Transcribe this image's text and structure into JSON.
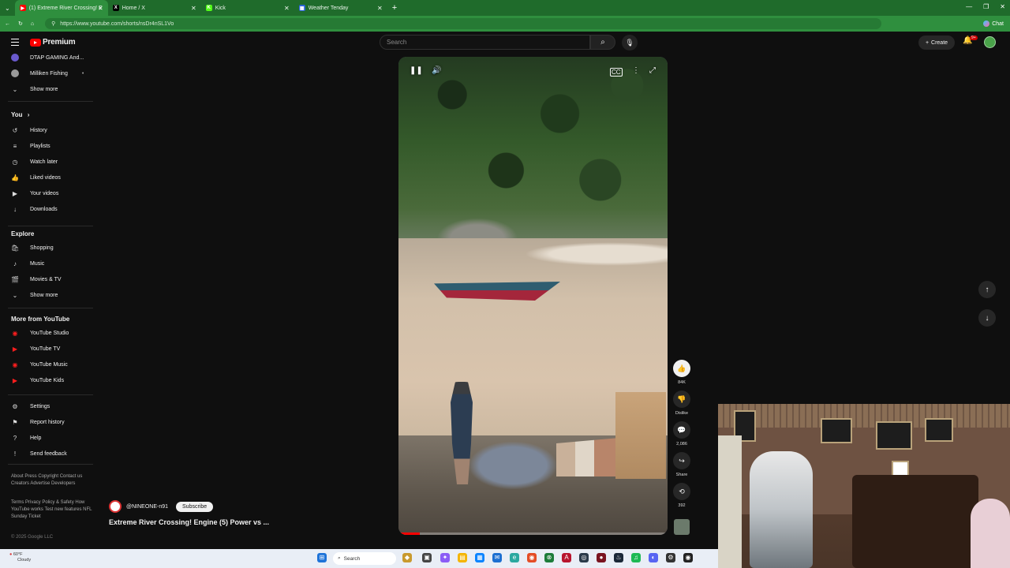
{
  "browser": {
    "tabs": [
      {
        "label": "(1) Extreme River Crossing! E",
        "color": "#ff0000",
        "glyph": "▶",
        "active": true
      },
      {
        "label": "Home / X",
        "color": "#000000",
        "glyph": "X",
        "active": false
      },
      {
        "label": "Kick",
        "color": "#53fc18",
        "glyph": "K",
        "active": false
      },
      {
        "label": "Weather Tenday",
        "color": "#2b65d9",
        "glyph": "▦",
        "active": false
      }
    ],
    "new_tab": "+",
    "url": "https://www.youtube.com/shorts/nsDr4nSL1Vo",
    "chat_label": "Chat"
  },
  "masthead": {
    "logo_text": "Premium",
    "search_placeholder": "Search",
    "create_label": "Create",
    "notif_count": "9+"
  },
  "sidebar": {
    "subscriptions": [
      {
        "label": "DTAP GAMING And...",
        "color": "#6a5acd"
      },
      {
        "label": "Milliken Fishing",
        "color": "#999999"
      }
    ],
    "show_more_1": "Show more",
    "you_heading": "You",
    "you_items": [
      {
        "label": "History",
        "icon": "history-icon",
        "glyph": "↺"
      },
      {
        "label": "Playlists",
        "icon": "playlists-icon",
        "glyph": "≡"
      },
      {
        "label": "Watch later",
        "icon": "watch-later-icon",
        "glyph": "◷"
      },
      {
        "label": "Liked videos",
        "icon": "liked-videos-icon",
        "glyph": "👍"
      },
      {
        "label": "Your videos",
        "icon": "your-videos-icon",
        "glyph": "▶"
      },
      {
        "label": "Downloads",
        "icon": "downloads-icon",
        "glyph": "↓"
      }
    ],
    "explore_heading": "Explore",
    "explore_items": [
      {
        "label": "Shopping",
        "icon": "shopping-icon",
        "glyph": "🛍"
      },
      {
        "label": "Music",
        "icon": "music-icon",
        "glyph": "♪"
      },
      {
        "label": "Movies & TV",
        "icon": "movies-icon",
        "glyph": "🎬"
      }
    ],
    "show_more_2": "Show more",
    "more_heading": "More from YouTube",
    "more_items": [
      {
        "label": "YouTube Studio",
        "icon": "youtube-studio-icon",
        "glyph": "◉"
      },
      {
        "label": "YouTube TV",
        "icon": "youtube-tv-icon",
        "glyph": "▶"
      },
      {
        "label": "YouTube Music",
        "icon": "youtube-music-icon",
        "glyph": "◉"
      },
      {
        "label": "YouTube Kids",
        "icon": "youtube-kids-icon",
        "glyph": "▶"
      }
    ],
    "settings_items": [
      {
        "label": "Settings",
        "icon": "settings-icon",
        "glyph": "⚙"
      },
      {
        "label": "Report history",
        "icon": "report-flag-icon",
        "glyph": "⚑"
      },
      {
        "label": "Help",
        "icon": "help-icon",
        "glyph": "?"
      },
      {
        "label": "Send feedback",
        "icon": "feedback-icon",
        "glyph": "!"
      }
    ],
    "footer_1": "About  Press  Copyright  Contact us  Creators  Advertise  Developers",
    "footer_2": "Terms  Privacy  Policy & Safety  How YouTube works  Test new features  NFL Sunday Ticket",
    "copyright": "© 2025 Google LLC"
  },
  "short": {
    "channel": "@NINEONE-n91",
    "subscribe_label": "Subscribe",
    "title": "Extreme River Crossing! Engine (5) Power vs ...",
    "progress": 0.08,
    "likes": "84K",
    "dislike_label": "Dislike",
    "comments": "2,086",
    "share_label": "Share",
    "remix_count": "392"
  },
  "taskbar": {
    "temp": "60°F",
    "condition": "Cloudy",
    "search_label": "Search"
  }
}
